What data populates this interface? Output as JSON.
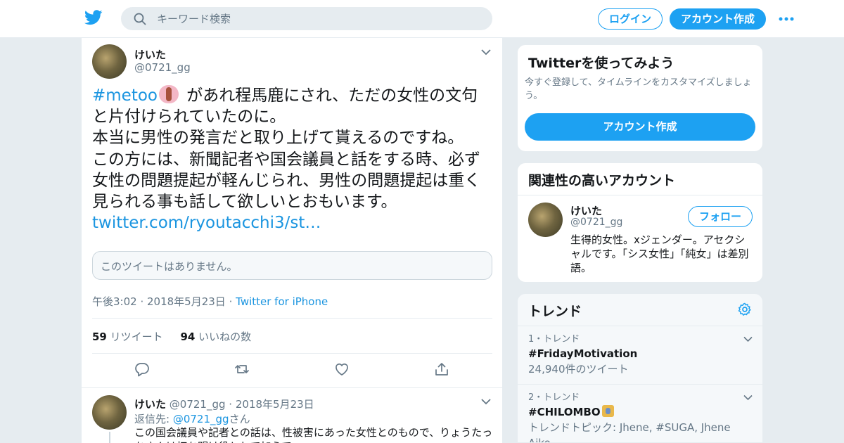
{
  "header": {
    "search_placeholder": "キーワード検索",
    "login_label": "ログイン",
    "signup_label": "アカウント作成"
  },
  "tweet": {
    "author_name": "けいた",
    "author_handle": "@0721_gg",
    "hashtag": "#metoo",
    "text_after_hashtag": " があれ程馬鹿にされ、ただの女性の文句と片付けられていたのに。",
    "line2": "本当に男性の発言だと取り上げて貰えるのですね。",
    "line3": "この方には、新聞記者や国会議員と話をする時、必ず女性の問題提起が軽んじられ、男性の問題提起は重く見られる事も話して欲しいとおもいます。",
    "link": "twitter.com/ryoutacchi3/st…",
    "quote_unavailable": "このツイートはありません。",
    "timestamp": "午後3:02 · 2018年5月23日",
    "dot": "·",
    "source": "Twitter for iPhone",
    "retweet_count": "59",
    "retweet_label": "リツイート",
    "like_count": "94",
    "like_label": "いいねの数"
  },
  "reply": {
    "author_name": "けいた",
    "author_handle": "@0721_gg",
    "dot": "·",
    "date": "2018年5月23日",
    "reply_to_prefix": "返信先:",
    "reply_to_handle": "@0721_gg",
    "reply_to_suffix": "さん",
    "text": "この国会議員や記者との話は、性被害にあった女性とのもので、りょうたっちさんは打ち明け役として加えて"
  },
  "signup_card": {
    "title": "Twitterを使ってみよう",
    "description": "今すぐ登録して、タイムラインをカスタマイズしましょう。",
    "button": "アカウント作成"
  },
  "related_card": {
    "title": "関連性の高いアカウント",
    "name": "けいた",
    "handle": "@0721_gg",
    "follow_label": "フォロー",
    "bio": "生得的女性。xジェンダー。アセクシャルです。「シス女性」「純女」は差別語。"
  },
  "trends": {
    "title": "トレンド",
    "items": [
      {
        "rank": "1・トレンド",
        "name": "#FridayMotivation",
        "detail": "24,940件のツイート"
      },
      {
        "rank": "2・トレンド",
        "name": "#CHILOMBO",
        "detail": "トレンドトピック: Jhene, #SUGA, Jhene Aiko"
      }
    ]
  },
  "colors": {
    "accent": "#1da1f2",
    "link": "#1b95e0",
    "background": "#e6ecf0"
  },
  "icons": [
    "twitter-bird-icon",
    "search-icon",
    "more-icon",
    "chevron-down-icon",
    "reply-icon",
    "retweet-icon",
    "like-icon",
    "share-icon",
    "gear-icon"
  ]
}
